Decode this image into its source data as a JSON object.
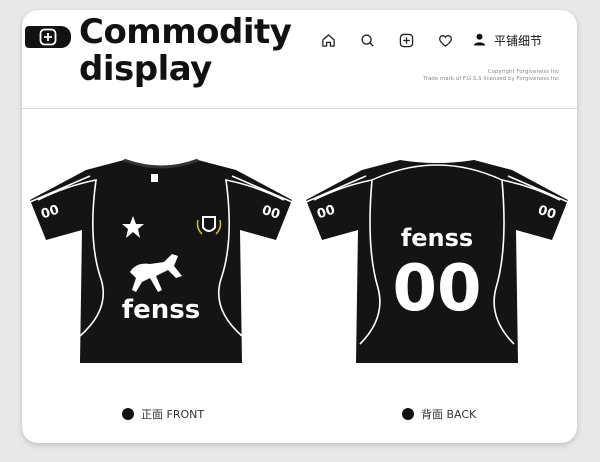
{
  "header": {
    "title_line1": "Commodity",
    "title_line2": "display",
    "nav_user_label": "平铺细节",
    "copyright_line1": "Copyright Forgiveness Inc",
    "copyright_line2": "Trade mark of F.G.S.S licensed by Forgiveness Inc"
  },
  "front": {
    "sleeve_number": "00",
    "brand": "fenss",
    "caption": "正面 FRONT"
  },
  "back": {
    "sleeve_number": "00",
    "brand": "fenss",
    "number": "00",
    "caption": "背面 BACK"
  },
  "colors": {
    "shirt": "#141414",
    "print": "#ffffff",
    "page_bg": "#e8e8e8"
  },
  "icons": [
    "plus-square-icon",
    "home-icon",
    "search-icon",
    "add-icon",
    "heart-icon",
    "user-icon",
    "star-logo-icon",
    "crest-icon",
    "horse-icon"
  ]
}
